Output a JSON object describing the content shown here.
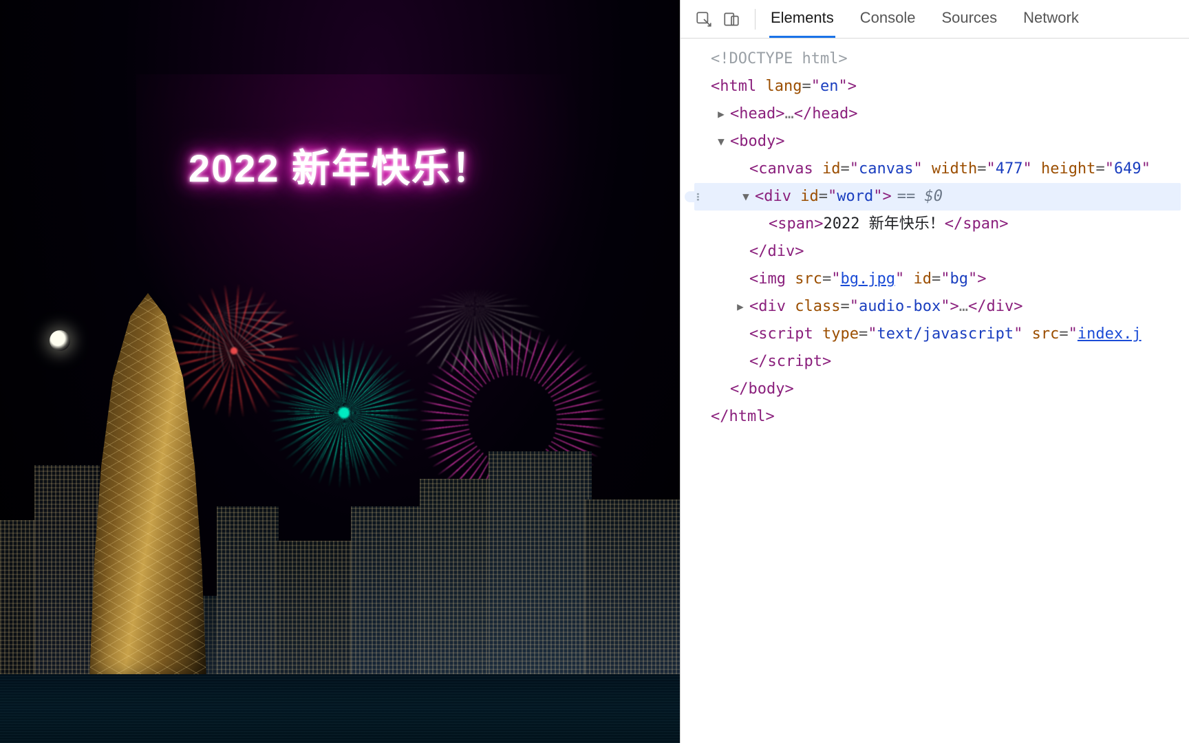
{
  "page": {
    "greeting": "2022 新年快乐！"
  },
  "devtools": {
    "tabs": [
      "Elements",
      "Console",
      "Sources",
      "Network"
    ],
    "active_tab": "Elements",
    "selected_marker": "== $0",
    "dom": {
      "doctype": "<!DOCTYPE html>",
      "html_open": {
        "tag": "html",
        "attr": "lang",
        "val": "en"
      },
      "head": {
        "tag": "head",
        "ellipsis": "…"
      },
      "body_open": {
        "tag": "body"
      },
      "canvas": {
        "tag": "canvas",
        "id": "canvas",
        "width": "477",
        "height": "649"
      },
      "word_div": {
        "tag": "div",
        "id": "word"
      },
      "word_span": {
        "tag": "span",
        "text": "2022 新年快乐！ "
      },
      "word_div_close": "div",
      "img": {
        "tag": "img",
        "src": "bg.jpg",
        "id": "bg"
      },
      "audio_box": {
        "tag": "div",
        "class": "audio-box",
        "ellipsis": "…"
      },
      "script": {
        "tag": "script",
        "type": "text/javascript",
        "src": "index.j"
      },
      "script_close": "script",
      "body_close": "body",
      "html_close": "html"
    }
  }
}
